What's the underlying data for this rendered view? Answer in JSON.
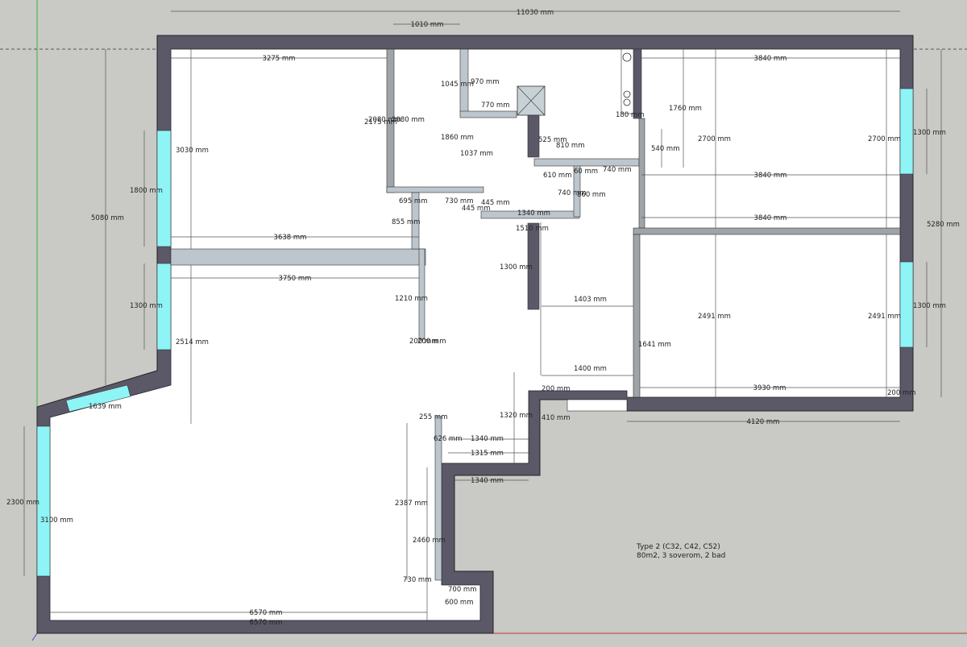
{
  "model_note": {
    "line1": "Type 2 (C32, C42, C52)",
    "line2": "80m2, 3 soverom, 2 bad"
  },
  "colors": {
    "background": "#c9c9c5",
    "wall": "#5b5868",
    "window_glass": "#8ef4f6",
    "partition": "#9ea4a8",
    "interior_panel": "#bcc6cc",
    "floor": "#ffffff",
    "dimension_line": "#555555"
  },
  "dimensions": {
    "overall_width": "11030 mm",
    "top_opening": "1010 mm",
    "living_top_width": "3275 mm",
    "right_room_width_a": "3840 mm",
    "right_room_width_b": "3840 mm",
    "right_room_width_c": "3840 mm",
    "shaft_offset": "1045 mm",
    "shaft_width": "970 mm",
    "shaft_depth": "770 mm",
    "corridor_left_a": "2080 mm",
    "corridor_left_b": "2080 mm",
    "corridor_left_c": "2175 mm",
    "hall_width": "1860 mm",
    "kitchen_depth": "1037 mm",
    "bath_a_offset": "525 mm",
    "bath_a_width": "810 mm",
    "bath_a_depth": "610 mm",
    "bath_a_opening": "60 mm",
    "bath_a_wall": "740 mm",
    "bath_a_side": "740 mm",
    "bath_a_height": "860 mm",
    "closet_a": "695 mm",
    "closet_b": "730 mm",
    "closet_c": "445 mm",
    "closet_d": "445 mm",
    "hall_bottom_a": "1340 mm",
    "hall_bottom_b": "1510 mm",
    "room_left_height": "3030 mm",
    "left_window_upper": "1800 mm",
    "total_left_height": "5080 mm",
    "partition_length_a": "3638 mm",
    "partition_length_b": "3750 mm",
    "stair_depth": "855 mm",
    "stair_width": "1210 mm",
    "stair_tread_a": "200 mm",
    "stair_tread_b": "200 mm",
    "left_window_lower": "1300 mm",
    "living_left_height": "2514 mm",
    "bay_window_width": "1639 mm",
    "bay_height": "2300 mm",
    "bay_window_height": "3100 mm",
    "bottom_width_a": "6570 mm",
    "bottom_width_b": "6570 mm",
    "kitchen_island_a": "255 mm",
    "kitchen_island_b": "626 mm",
    "kitchen_width_a": "1340 mm",
    "kitchen_width_b": "1315 mm",
    "kitchen_width_c": "1340 mm",
    "kitchen_depth_a": "2387 mm",
    "kitchen_depth_b": "2460 mm",
    "kitchen_depth_c": "1320 mm",
    "kitchen_bottom_a": "730 mm",
    "kitchen_bottom_b": "700 mm",
    "kitchen_bottom_c": "600 mm",
    "corridor_width": "1403 mm",
    "corridor_width_b": "1400 mm",
    "corridor_wall": "1300 mm",
    "bedroom_upper_height_a": "2700 mm",
    "bedroom_upper_height_b": "2700 mm",
    "closet_right_a": "1760 mm",
    "closet_right_b": "540 mm",
    "bath_b_label": "180 mm",
    "bedroom_lower_height_a": "2491 mm",
    "bedroom_lower_height_b": "2491 mm",
    "bedroom_lower_wall": "1641 mm",
    "right_window_upper": "1300 mm",
    "right_window_lower": "1300 mm",
    "total_right_height": "5280 mm",
    "bedroom_bottom_width": "3930 mm",
    "bedroom_outer_width": "4120 mm",
    "door_gap_a": "200 mm",
    "door_gap_b": "410 mm",
    "door_gap_c": "200 mm"
  }
}
